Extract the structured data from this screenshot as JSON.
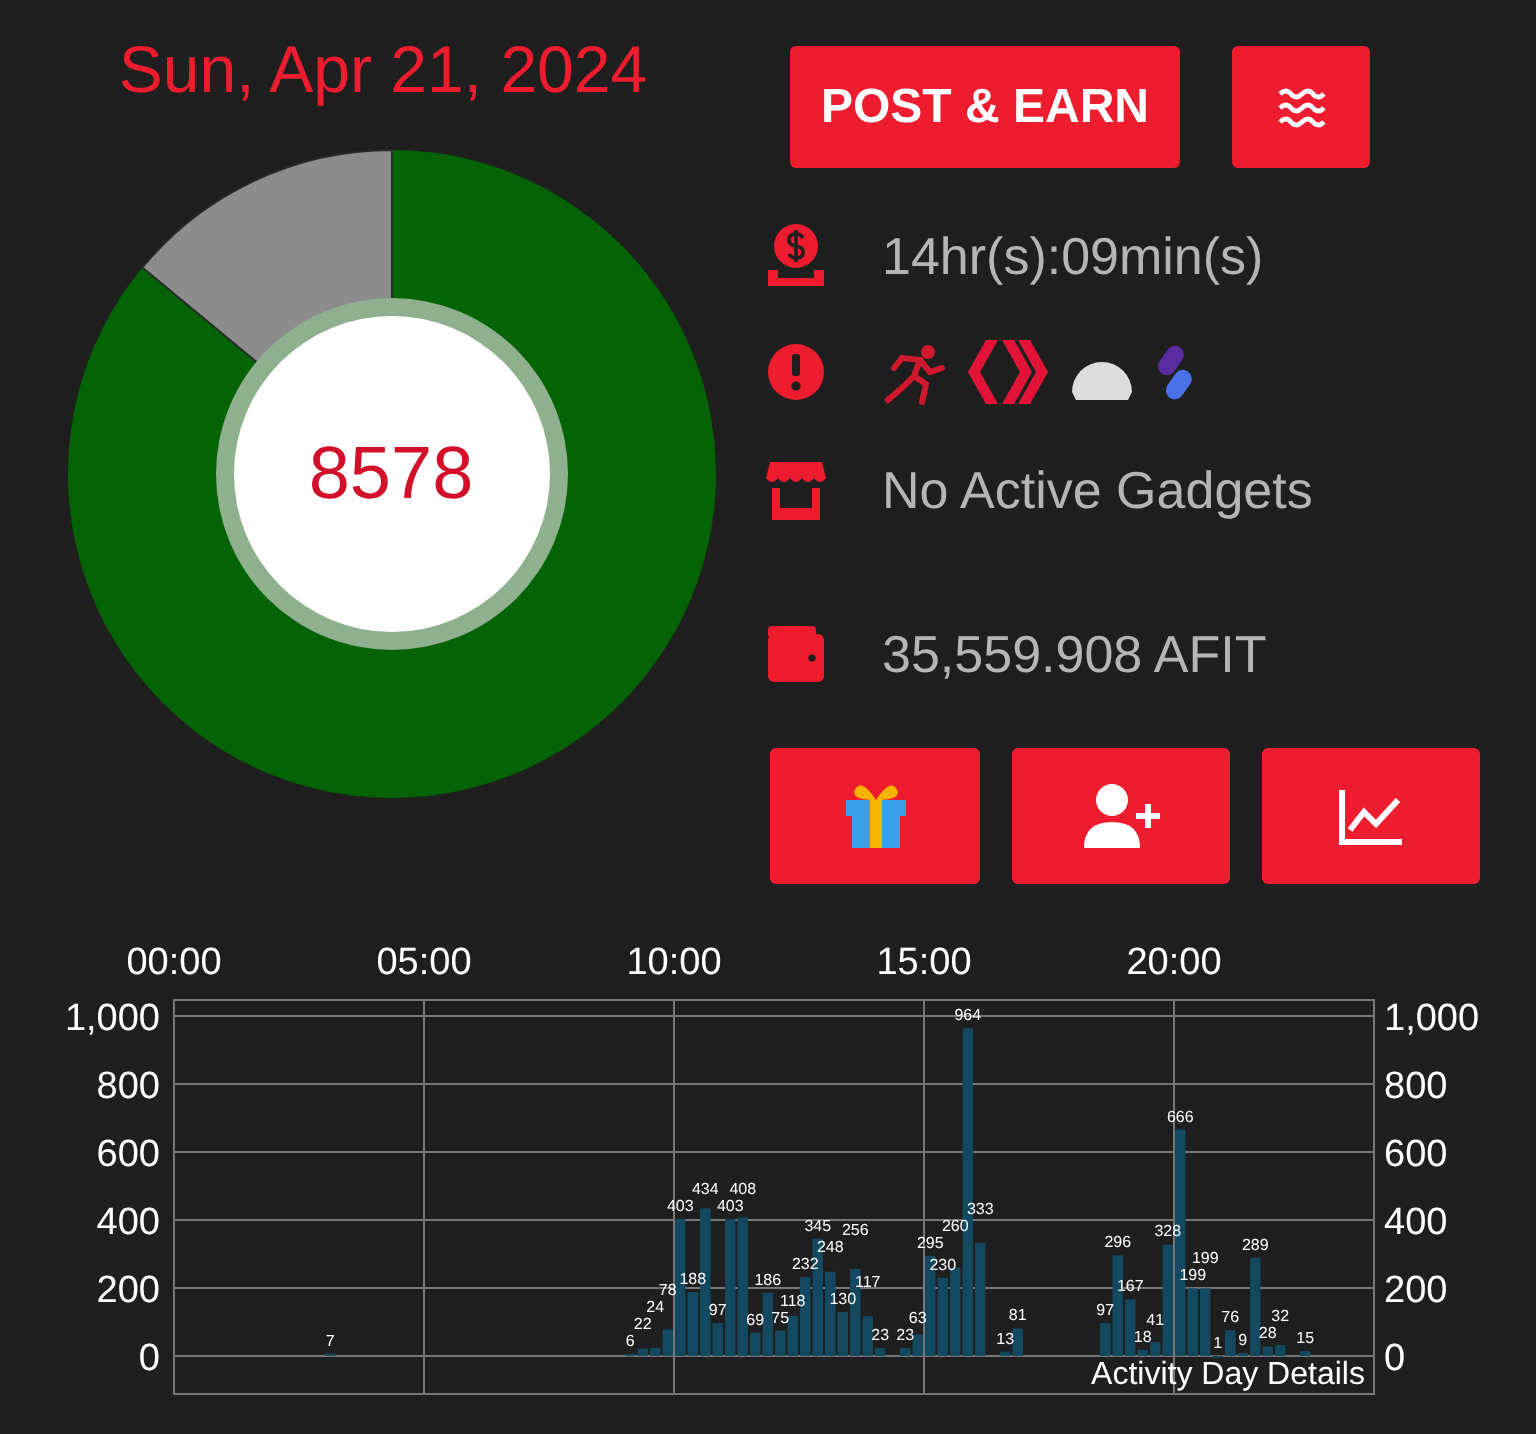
{
  "date": "Sun, Apr 21, 2024",
  "activity_ring": {
    "value": "8578"
  },
  "buttons": {
    "post": "POST & EARN"
  },
  "stats": {
    "time": "14hr(s):09min(s)",
    "gadgets": "No Active Gadgets",
    "balance": "35,559.908 AFIT"
  },
  "chart_data": {
    "type": "bar",
    "title": "Activity Day Details",
    "data_labels": true,
    "grid": true,
    "xlim": [
      0,
      24
    ],
    "ylim": [
      0,
      1000
    ],
    "xticks": [
      {
        "value": 0,
        "label": "00:00"
      },
      {
        "value": 5,
        "label": "05:00"
      },
      {
        "value": 10,
        "label": "10:00"
      },
      {
        "value": 15,
        "label": "15:00"
      },
      {
        "value": 20,
        "label": "20:00"
      }
    ],
    "yticks": [
      {
        "value": 0,
        "label": "0"
      },
      {
        "value": 200,
        "label": "200"
      },
      {
        "value": 400,
        "label": "400"
      },
      {
        "value": 600,
        "label": "600"
      },
      {
        "value": 800,
        "label": "800"
      },
      {
        "value": 1000,
        "label": "1,000"
      }
    ],
    "x": [
      3.125,
      9.125,
      9.375,
      9.625,
      9.875,
      10.125,
      10.375,
      10.625,
      10.875,
      11.125,
      11.375,
      11.625,
      11.875,
      12.125,
      12.375,
      12.625,
      12.875,
      13.125,
      13.375,
      13.625,
      13.875,
      14.125,
      14.625,
      14.875,
      15.125,
      15.375,
      15.625,
      15.875,
      16.125,
      16.625,
      16.875,
      18.625,
      18.875,
      19.125,
      19.375,
      19.625,
      19.875,
      20.125,
      20.375,
      20.625,
      20.875,
      21.125,
      21.375,
      21.625,
      21.875,
      22.125,
      22.625
    ],
    "series": [
      {
        "color": "#134a62",
        "values": [
          7,
          6,
          22,
          24,
          78,
          403,
          188,
          434,
          97,
          403,
          408,
          69,
          186,
          75,
          118,
          232,
          345,
          248,
          130,
          256,
          117,
          23,
          23,
          63,
          295,
          230,
          260,
          964,
          333,
          13,
          81,
          97,
          296,
          167,
          18,
          41,
          328,
          666,
          199,
          199,
          1,
          76,
          9,
          289,
          28,
          32,
          15
        ]
      }
    ]
  }
}
